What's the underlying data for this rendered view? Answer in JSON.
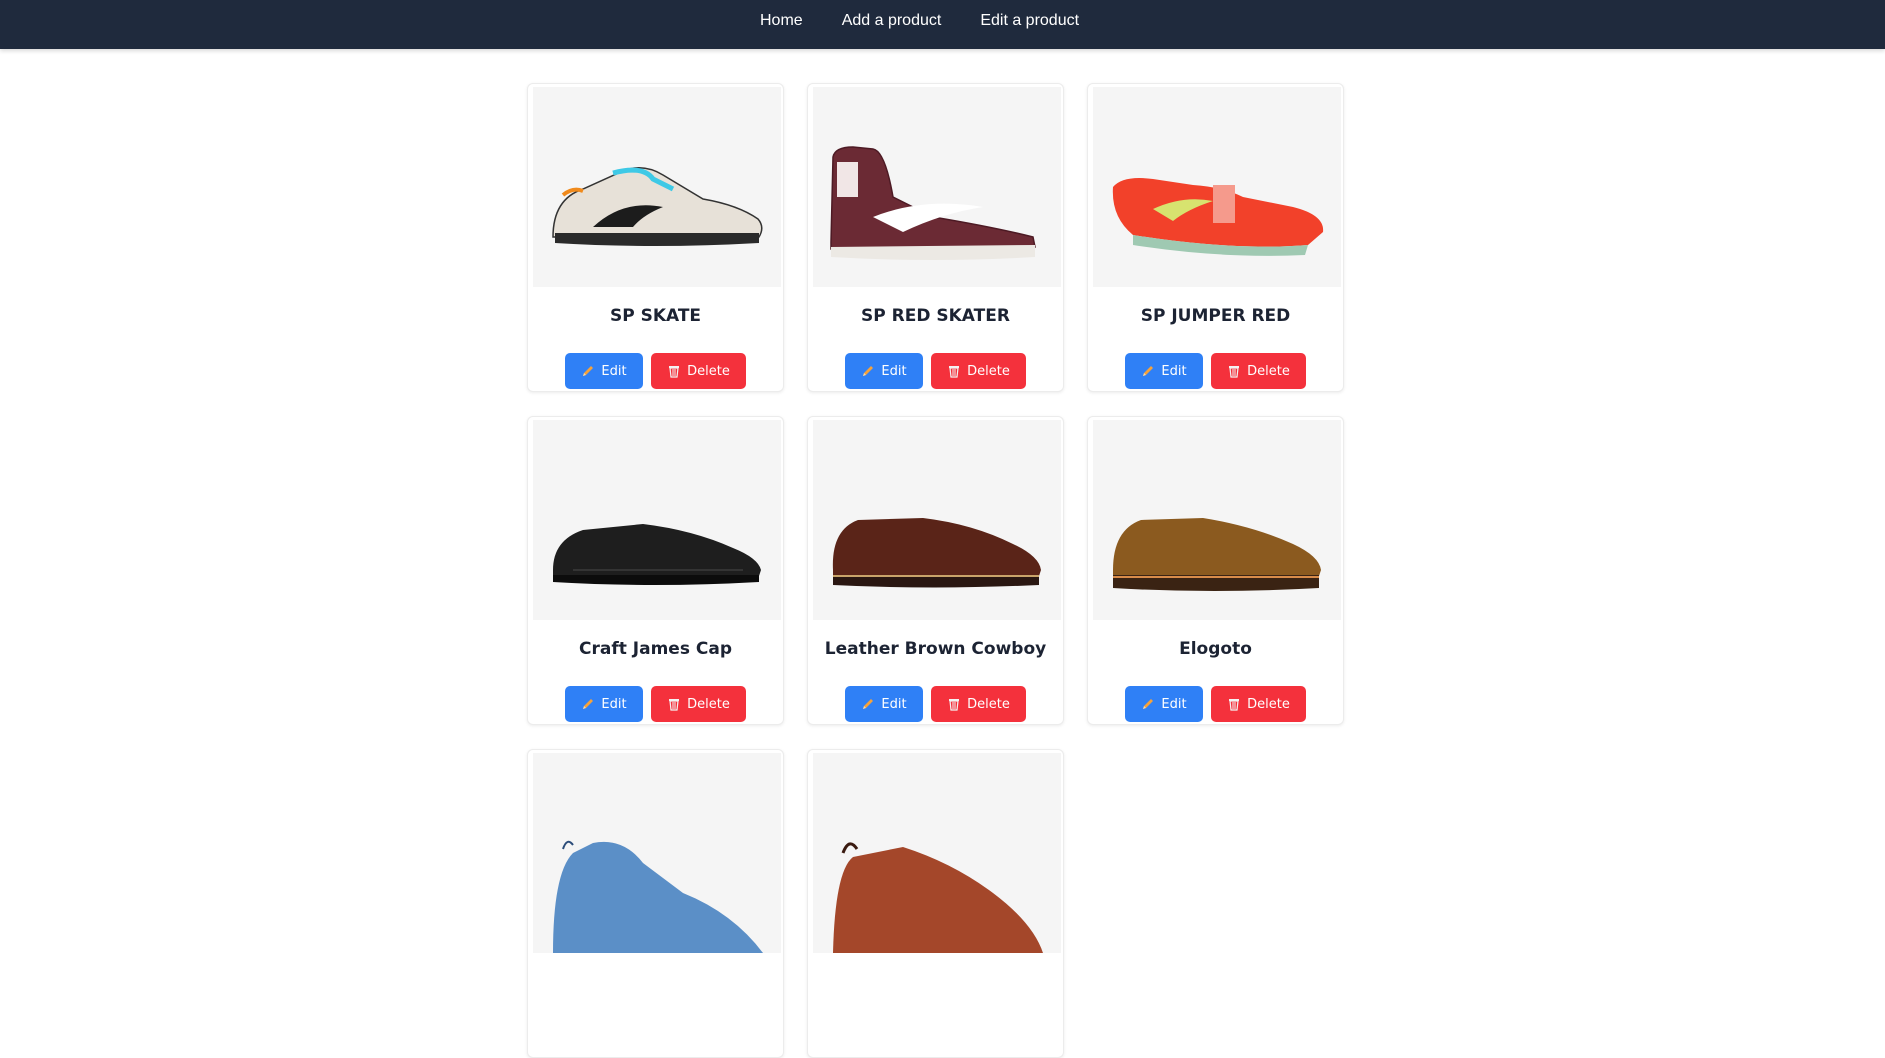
{
  "nav": {
    "links": [
      "Home",
      "Add a product",
      "Edit a product"
    ]
  },
  "buttons": {
    "edit_label": "Edit",
    "delete_label": "Delete"
  },
  "colors": {
    "navbar": "#1f2a3d",
    "edit_button": "#2f80f6",
    "delete_button": "#f4313c"
  },
  "products": [
    {
      "name": "SP SKATE",
      "image": "sneaker-safari-icon"
    },
    {
      "name": "SP RED SKATER",
      "image": "sneaker-burgundy-high-icon"
    },
    {
      "name": "SP JUMPER RED",
      "image": "spike-red-icon"
    },
    {
      "name": "Craft James Cap",
      "image": "oxford-black-icon"
    },
    {
      "name": "Leather Brown Cowboy",
      "image": "brogue-brown-icon"
    },
    {
      "name": "Elogoto",
      "image": "suede-brown-icon"
    },
    {
      "name": "",
      "image": "blue-sneaker-icon"
    },
    {
      "name": "",
      "image": "rust-shoe-icon"
    }
  ]
}
